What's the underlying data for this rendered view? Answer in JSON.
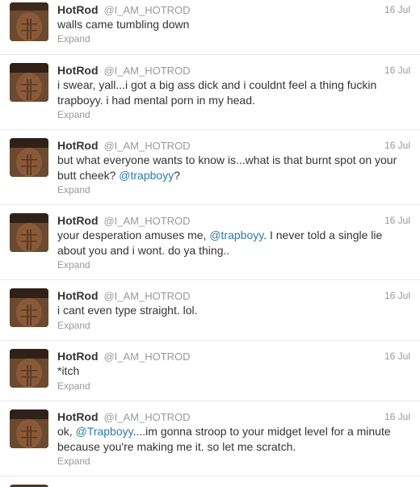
{
  "author": {
    "fullname": "HotRod",
    "username": "@I_AM_HOTROD"
  },
  "expand_label": "Expand",
  "tweets": [
    {
      "time": "16 Jul",
      "text_parts": [
        "walls came tumbling down"
      ],
      "mention": "",
      "after_mention": ""
    },
    {
      "time": "16 Jul",
      "text_parts": [
        "i swear, yall...i got a big ass dick and i couldnt feel a thing fuckin trapboyy. i had mental porn in my head."
      ],
      "mention": "",
      "after_mention": ""
    },
    {
      "time": "16 Jul",
      "text_parts": [
        "but what everyone wants to know is...what is that burnt spot on your butt cheek? "
      ],
      "mention": "@trapboyy",
      "after_mention": "?"
    },
    {
      "time": "16 Jul",
      "text_parts": [
        "your desperation amuses me, "
      ],
      "mention": "@trapboyy",
      "after_mention": ". I never told a single lie about you and i wont. do ya thing.."
    },
    {
      "time": "16 Jul",
      "text_parts": [
        "i cant even type straight. lol."
      ],
      "mention": "",
      "after_mention": ""
    },
    {
      "time": "16 Jul",
      "text_parts": [
        "*itch"
      ],
      "mention": "",
      "after_mention": ""
    },
    {
      "time": "16 Jul",
      "text_parts": [
        "ok, "
      ],
      "mention": "@Trapboyy",
      "after_mention": "....im gonna stroop to your midget level for a minute because you're making me it. so let me scratch."
    }
  ],
  "colors": {
    "mention": "#2a7aae",
    "meta": "#999999",
    "divider": "#e8e8e8"
  }
}
